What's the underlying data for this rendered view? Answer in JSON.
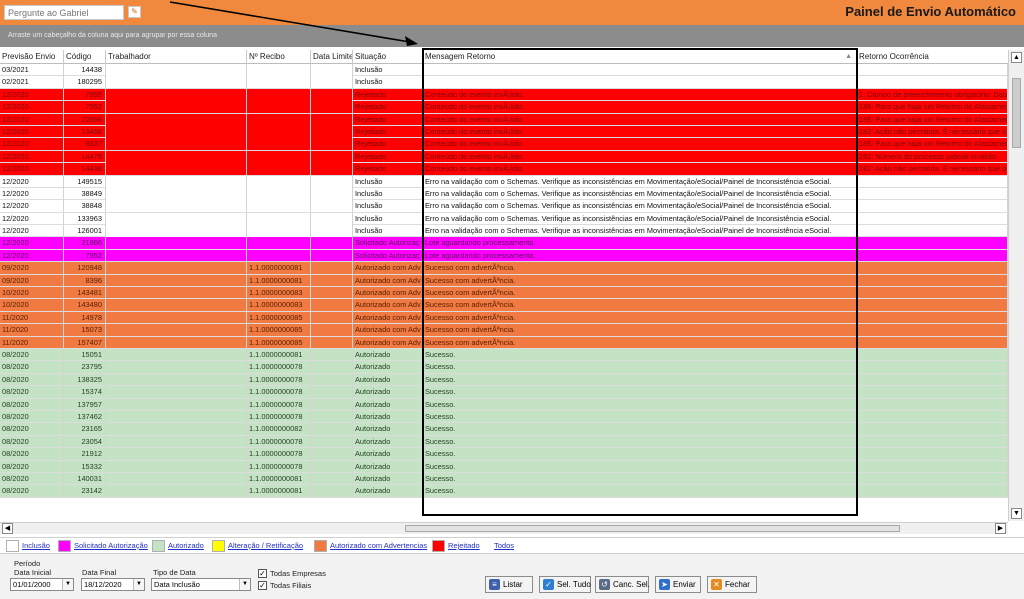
{
  "header": {
    "ask_placeholder": "Pergunte ao Gabriel",
    "title": "Painel de Envio Automático"
  },
  "group_hint": "Arraste um cabeçalho da coluna aqui para agrupar por essa coluna",
  "columns": [
    "Previsão Envio",
    "Código",
    "Trabalhador",
    "Nº Recibo",
    "Data Limite",
    "Situação",
    "Mensagem Retorno",
    "Retorno Ocorrência"
  ],
  "row_colors": {
    "white": "#ffffff",
    "red": "#ff0000",
    "magenta": "#ff00ff",
    "orange": "#f07a42",
    "green": "#c4e2c4"
  },
  "rows": [
    {
      "c": "white",
      "d": "03/2021",
      "cod": "14438",
      "rec": "",
      "sit": "Inclusão",
      "msg": "",
      "oc": ""
    },
    {
      "c": "white",
      "d": "02/2021",
      "cod": "180295",
      "rec": "",
      "sit": "Inclusão",
      "msg": "",
      "oc": ""
    },
    {
      "c": "red",
      "d": "12/2020",
      "cod": "7955",
      "rec": "",
      "sit": "Rejeitado",
      "msg": "Conteúdo do evento invÃ¡lido.",
      "oc": "1: Campo de preenchimento obrigatório: Data"
    },
    {
      "c": "red",
      "d": "12/2020",
      "cod": "7952",
      "rec": "",
      "sit": "Rejeitado",
      "msg": "Conteúdo do evento invÃ¡lido.",
      "oc": "186: Para que haja um Retorno do Afastamen"
    },
    {
      "c": "red",
      "d": "12/2020",
      "cod": "22866",
      "rec": "",
      "sit": "Rejeitado",
      "msg": "Conteúdo do evento invÃ¡lido.",
      "oc": "186: Para que haja um Retorno do Afastamen"
    },
    {
      "c": "red",
      "d": "12/2020",
      "cod": "13466",
      "rec": "",
      "sit": "Rejeitado",
      "msg": "Conteúdo do evento invÃ¡lido.",
      "oc": "182: Ação não permitida. É necessário que o"
    },
    {
      "c": "red",
      "d": "12/2020",
      "cod": "8537",
      "rec": "",
      "sit": "Rejeitado",
      "msg": "Conteúdo do evento invÃ¡lido.",
      "oc": "186: Para que haja um Retorno do Afastamen"
    },
    {
      "c": "red",
      "d": "12/2020",
      "cod": "14478",
      "rec": "",
      "sit": "Rejeitado",
      "msg": "Conteúdo do evento invÃ¡lido.",
      "oc": "282: Número do processo judicial inválido."
    },
    {
      "c": "red",
      "d": "12/2020",
      "cod": "14438",
      "rec": "",
      "sit": "Rejeitado",
      "msg": "Conteúdo do evento invÃ¡lido.",
      "oc": "182: Ação não permitida. É necessário que o"
    },
    {
      "c": "white",
      "d": "12/2020",
      "cod": "149515",
      "rec": "",
      "sit": "Inclusão",
      "msg": "Erro na validação com o Schemas. Verifique as inconsistências em Movimentação/eSocial/Painel de Inconsistência eSocial.",
      "oc": ""
    },
    {
      "c": "white",
      "d": "12/2020",
      "cod": "38849",
      "rec": "",
      "sit": "Inclusão",
      "msg": "Erro na validação com o Schemas. Verifique as inconsistências em Movimentação/eSocial/Painel de Inconsistência eSocial.",
      "oc": ""
    },
    {
      "c": "white",
      "d": "12/2020",
      "cod": "38848",
      "rec": "",
      "sit": "Inclusão",
      "msg": "Erro na validação com o Schemas. Verifique as inconsistências em Movimentação/eSocial/Painel de Inconsistência eSocial.",
      "oc": ""
    },
    {
      "c": "white",
      "d": "12/2020",
      "cod": "133963",
      "rec": "",
      "sit": "Inclusão",
      "msg": "Erro na validação com o Schemas. Verifique as inconsistências em Movimentação/eSocial/Painel de Inconsistência eSocial.",
      "oc": ""
    },
    {
      "c": "white",
      "d": "12/2020",
      "cod": "126001",
      "rec": "",
      "sit": "Inclusão",
      "msg": "Erro na validação com o Schemas. Verifique as inconsistências em Movimentação/eSocial/Painel de Inconsistência eSocial.",
      "oc": ""
    },
    {
      "c": "magenta",
      "d": "12/2020",
      "cod": "21866",
      "rec": "",
      "sit": "Solicitado Autorizaç",
      "msg": "Lote aguardando processamento.",
      "oc": ""
    },
    {
      "c": "magenta",
      "d": "12/2020",
      "cod": "7952",
      "rec": "",
      "sit": "Solicitado Autorizaç",
      "msg": "Lote aguardando processamento.",
      "oc": ""
    },
    {
      "c": "orange",
      "d": "09/2020",
      "cod": "120948",
      "rec": "1.1.0000000081",
      "sit": "Autorizado com Adv",
      "msg": "Sucesso com advertÃªncia.",
      "oc": ""
    },
    {
      "c": "orange",
      "d": "09/2020",
      "cod": "8396",
      "rec": "1.1.0000000081",
      "sit": "Autorizado com Adv",
      "msg": "Sucesso com advertÃªncia.",
      "oc": ""
    },
    {
      "c": "orange",
      "d": "10/2020",
      "cod": "143481",
      "rec": "1.1.0000000083",
      "sit": "Autorizado com Adv",
      "msg": "Sucesso com advertÃªncia.",
      "oc": ""
    },
    {
      "c": "orange",
      "d": "10/2020",
      "cod": "143480",
      "rec": "1.1.0000000083",
      "sit": "Autorizado com Adv",
      "msg": "Sucesso com advertÃªncia.",
      "oc": ""
    },
    {
      "c": "orange",
      "d": "11/2020",
      "cod": "14978",
      "rec": "1.1.0000000085",
      "sit": "Autorizado com Adv",
      "msg": "Sucesso com advertÃªncia.",
      "oc": ""
    },
    {
      "c": "orange",
      "d": "11/2020",
      "cod": "15073",
      "rec": "1.1.0000000085",
      "sit": "Autorizado com Adv",
      "msg": "Sucesso com advertÃªncia.",
      "oc": ""
    },
    {
      "c": "orange",
      "d": "11/2020",
      "cod": "157407",
      "rec": "1.1.0000000085",
      "sit": "Autorizado com Adv",
      "msg": "Sucesso com advertÃªncia.",
      "oc": ""
    },
    {
      "c": "green",
      "d": "08/2020",
      "cod": "15051",
      "rec": "1.1.0000000081",
      "sit": "Autorizado",
      "msg": "Sucesso.",
      "oc": ""
    },
    {
      "c": "green",
      "d": "08/2020",
      "cod": "23795",
      "rec": "1.1.0000000078",
      "sit": "Autorizado",
      "msg": "Sucesso.",
      "oc": ""
    },
    {
      "c": "green",
      "d": "08/2020",
      "cod": "138325",
      "rec": "1.1.0000000078",
      "sit": "Autorizado",
      "msg": "Sucesso.",
      "oc": ""
    },
    {
      "c": "green",
      "d": "08/2020",
      "cod": "15374",
      "rec": "1.1.0000000078",
      "sit": "Autorizado",
      "msg": "Sucesso.",
      "oc": ""
    },
    {
      "c": "green",
      "d": "08/2020",
      "cod": "137957",
      "rec": "1.1.0000000078",
      "sit": "Autorizado",
      "msg": "Sucesso.",
      "oc": ""
    },
    {
      "c": "green",
      "d": "08/2020",
      "cod": "137462",
      "rec": "1.1.0000000078",
      "sit": "Autorizado",
      "msg": "Sucesso.",
      "oc": ""
    },
    {
      "c": "green",
      "d": "08/2020",
      "cod": "23165",
      "rec": "1.1.0000000082",
      "sit": "Autorizado",
      "msg": "Sucesso.",
      "oc": ""
    },
    {
      "c": "green",
      "d": "08/2020",
      "cod": "23054",
      "rec": "1.1.0000000078",
      "sit": "Autorizado",
      "msg": "Sucesso.",
      "oc": ""
    },
    {
      "c": "green",
      "d": "08/2020",
      "cod": "21912",
      "rec": "1.1.0000000078",
      "sit": "Autorizado",
      "msg": "Sucesso.",
      "oc": ""
    },
    {
      "c": "green",
      "d": "08/2020",
      "cod": "15332",
      "rec": "1.1.0000000078",
      "sit": "Autorizado",
      "msg": "Sucesso.",
      "oc": ""
    },
    {
      "c": "green",
      "d": "08/2020",
      "cod": "140031",
      "rec": "1.1.0000000081",
      "sit": "Autorizado",
      "msg": "Sucesso.",
      "oc": ""
    },
    {
      "c": "green",
      "d": "08/2020",
      "cod": "23142",
      "rec": "1.1.0000000081",
      "sit": "Autorizado",
      "msg": "Sucesso.",
      "oc": ""
    }
  ],
  "legend": [
    {
      "label": "Inclusão",
      "color": "#ffffff"
    },
    {
      "label": "Solicitado Autorização",
      "color": "#ff00ff"
    },
    {
      "label": "Autorizado",
      "color": "#c4e2c4"
    },
    {
      "label": "Alteração / Retificação",
      "color": "#ffff00"
    },
    {
      "label": "Autorizado com Advertencias",
      "color": "#f07a42"
    },
    {
      "label": "Rejeitado",
      "color": "#ff0000"
    }
  ],
  "legend_all": "Todos",
  "filters": {
    "periodo_label": "Período",
    "data_inicial_label": "Data Inicial",
    "data_inicial": "01/01/2000",
    "data_final_label": "Data Final",
    "data_final": "18/12/2020",
    "tipo_data_label": "Tipo de Data",
    "tipo_data": "Data Inclusão",
    "todas_empresas": "Todas Empresas",
    "todas_filiais": "Todas Filiais"
  },
  "buttons": {
    "listar": "Listar",
    "sel_tudo": "Sel. Tudo",
    "canc_sel": "Canc. Sel.",
    "enviar": "Enviar",
    "fechar": "Fechar"
  }
}
